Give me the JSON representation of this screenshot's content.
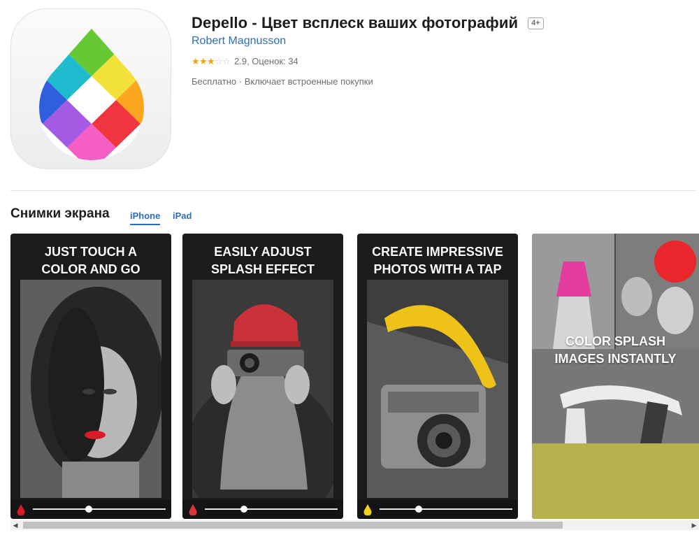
{
  "app": {
    "title": "Depello - Цвет всплеск ваших фотографий",
    "age_rating": "4+",
    "developer": "Robert Magnusson",
    "rating_text": "2.9, Оценок: 34",
    "stars": [
      1,
      1,
      1,
      0,
      0
    ],
    "price_text": "Бесплатно · Включает встроенные покупки",
    "icon_name": "depello-color-drop-icon"
  },
  "screenshots": {
    "title": "Снимки экрана",
    "tabs": [
      {
        "label": "iPhone",
        "selected": true
      },
      {
        "label": "iPad",
        "selected": false
      }
    ],
    "items": [
      {
        "caption_line1": "JUST TOUCH A",
        "caption_line2": "COLOR AND GO",
        "accent": "#d81c27",
        "slider_value": 0.43
      },
      {
        "caption_line1": "EASILY ADJUST",
        "caption_line2": "SPLASH EFFECT",
        "accent": "#d8343a",
        "slider_value": 0.28
      },
      {
        "caption_line1": "CREATE IMPRESSIVE",
        "caption_line2": "PHOTOS WITH A TAP",
        "accent": "#f4d21c",
        "slider_value": 0.28
      },
      {
        "caption_line1": "COLOR SPLASH",
        "caption_line2": "IMAGES INSTANTLY",
        "accent": "#f2d640"
      }
    ]
  },
  "colors": {
    "link": "#2b6fb6",
    "star": "#f0a500"
  }
}
